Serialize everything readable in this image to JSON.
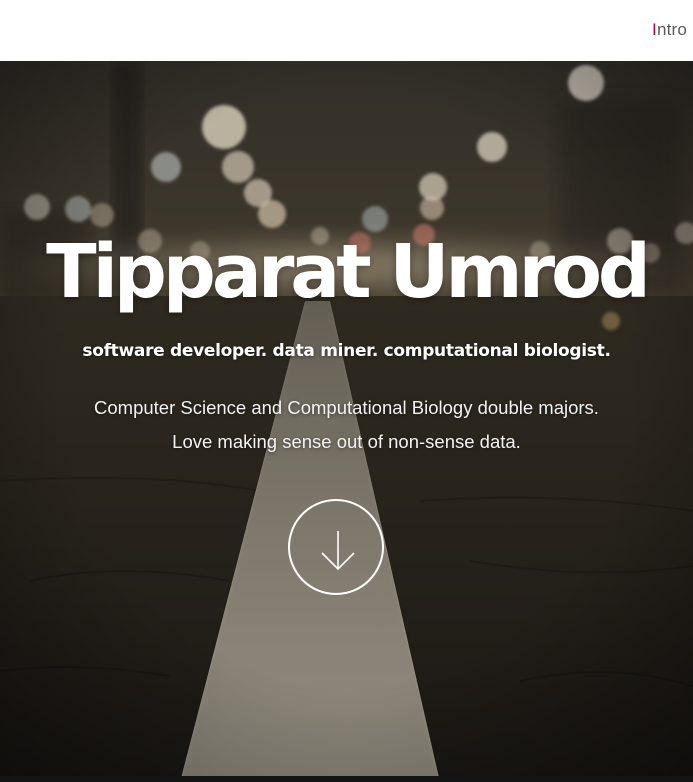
{
  "nav": {
    "items": [
      {
        "label": "Intro"
      }
    ]
  },
  "hero": {
    "title": "Tipparat Umrod",
    "subtitle": "software developer. data miner. computational biologist.",
    "description_line1": "Computer Science and Computational Biology double majors.",
    "description_line2": "Love making sense out of non-sense data.",
    "scroll_icon": "arrow-down-icon",
    "background": "night road with blurred street lights"
  },
  "colors": {
    "nav_bg": "#ffffff",
    "nav_text": "#5a5a5a",
    "nav_accent": "#b1004a",
    "hero_text": "#ffffff"
  }
}
